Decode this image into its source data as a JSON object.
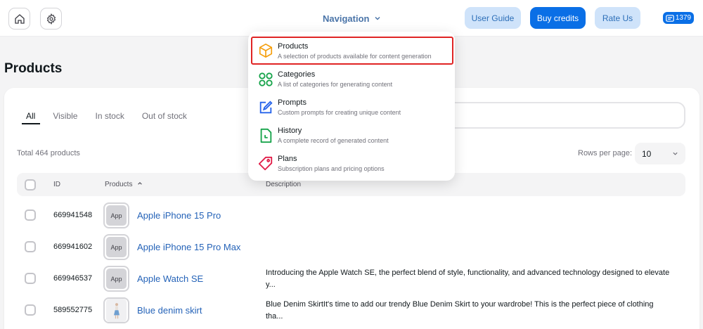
{
  "header": {
    "nav_label": "Navigation",
    "user_guide": "User Guide",
    "buy_credits": "Buy credits",
    "rate_us": "Rate Us",
    "credits": "1379"
  },
  "page": {
    "title": "Products"
  },
  "tabs": [
    "All",
    "Visible",
    "In stock",
    "Out of stock"
  ],
  "active_tab": "All",
  "total": "Total 464 products",
  "rows_per_page": {
    "label": "Rows per page:",
    "value": "10"
  },
  "table": {
    "headers": {
      "id": "ID",
      "products": "Products",
      "description": "Description"
    },
    "rows": [
      {
        "id": "669941548",
        "thumb": "App",
        "name": "Apple iPhone 15 Pro",
        "desc1": "",
        "desc2": ""
      },
      {
        "id": "669941602",
        "thumb": "App",
        "name": "Apple iPhone 15 Pro Max",
        "desc1": "",
        "desc2": ""
      },
      {
        "id": "669946537",
        "thumb": "App",
        "name": "Apple Watch SE",
        "desc1": "Introducing the Apple Watch SE, the perfect blend of style, functionality, and advanced technology designed to elevate",
        "desc2": "y..."
      },
      {
        "id": "589552775",
        "thumb": "",
        "name": "Blue denim skirt",
        "desc1": "Blue Denim SkirtIt's time to add our trendy Blue Denim Skirt to your wardrobe! This is the perfect piece of clothing",
        "desc2": "tha..."
      }
    ]
  },
  "dropdown": {
    "items": [
      {
        "title": "Products",
        "desc": "A selection of products available for content generation",
        "icon": "box-icon",
        "color": "#f59e0b"
      },
      {
        "title": "Categories",
        "desc": "A list of categories for generating content",
        "icon": "grid-icon",
        "color": "#16a34a"
      },
      {
        "title": "Prompts",
        "desc": "Custom prompts for creating unique content",
        "icon": "edit-icon",
        "color": "#2563eb"
      },
      {
        "title": "History",
        "desc": "A complete record of generated content",
        "icon": "history-icon",
        "color": "#16a34a"
      },
      {
        "title": "Plans",
        "desc": "Subscription plans and pricing options",
        "icon": "tag-icon",
        "color": "#e11d48"
      }
    ]
  },
  "colors": {
    "accent": "#0a6fe6",
    "link": "#2563b8",
    "selection": "#e02424"
  }
}
